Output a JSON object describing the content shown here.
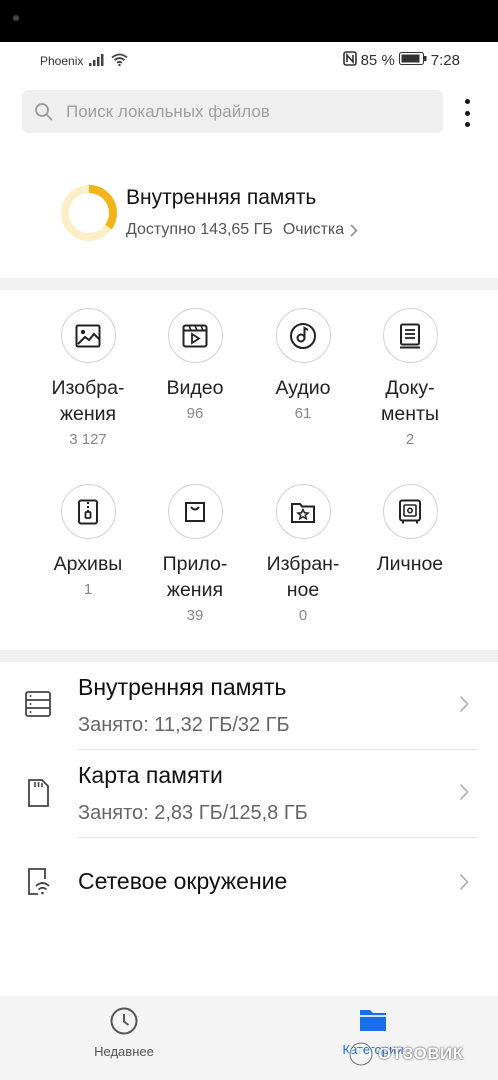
{
  "status": {
    "carrier": "Phoenix",
    "battery": "85 %",
    "time": "7:28"
  },
  "search": {
    "placeholder": "Поиск локальных файлов"
  },
  "storage_summary": {
    "title": "Внутренняя память",
    "available": "Доступно 143,65 ГБ",
    "clean_label": "Очистка",
    "used_fraction": 0.35
  },
  "categories": [
    {
      "label": "Изобра-\nжения",
      "count": "3 127",
      "icon": "image-icon"
    },
    {
      "label": "Видео",
      "count": "96",
      "icon": "video-icon"
    },
    {
      "label": "Аудио",
      "count": "61",
      "icon": "audio-icon"
    },
    {
      "label": "Доку-\nменты",
      "count": "2",
      "icon": "document-icon"
    },
    {
      "label": "Архивы",
      "count": "1",
      "icon": "archive-icon"
    },
    {
      "label": "Прило-\nжения",
      "count": "39",
      "icon": "apps-icon"
    },
    {
      "label": "Избран-\nное",
      "count": "0",
      "icon": "favorites-icon"
    },
    {
      "label": "Личное",
      "count": "",
      "icon": "safe-icon"
    }
  ],
  "locations": [
    {
      "title": "Внутренняя память",
      "sub": "Занято: 11,32 ГБ/32 ГБ",
      "icon": "internal-storage-icon"
    },
    {
      "title": "Карта памяти",
      "sub": "Занято: 2,83 ГБ/125,8 ГБ",
      "icon": "sd-card-icon"
    },
    {
      "title": "Сетевое окружение",
      "sub": "",
      "icon": "network-icon"
    }
  ],
  "nav": {
    "recent": "Недавнее",
    "categories": "Категории"
  },
  "watermark": "ОТЗОВИК",
  "colors": {
    "accent": "#1a6ee8",
    "ring_used": "#f2b418",
    "ring_free": "#fbefc7"
  }
}
